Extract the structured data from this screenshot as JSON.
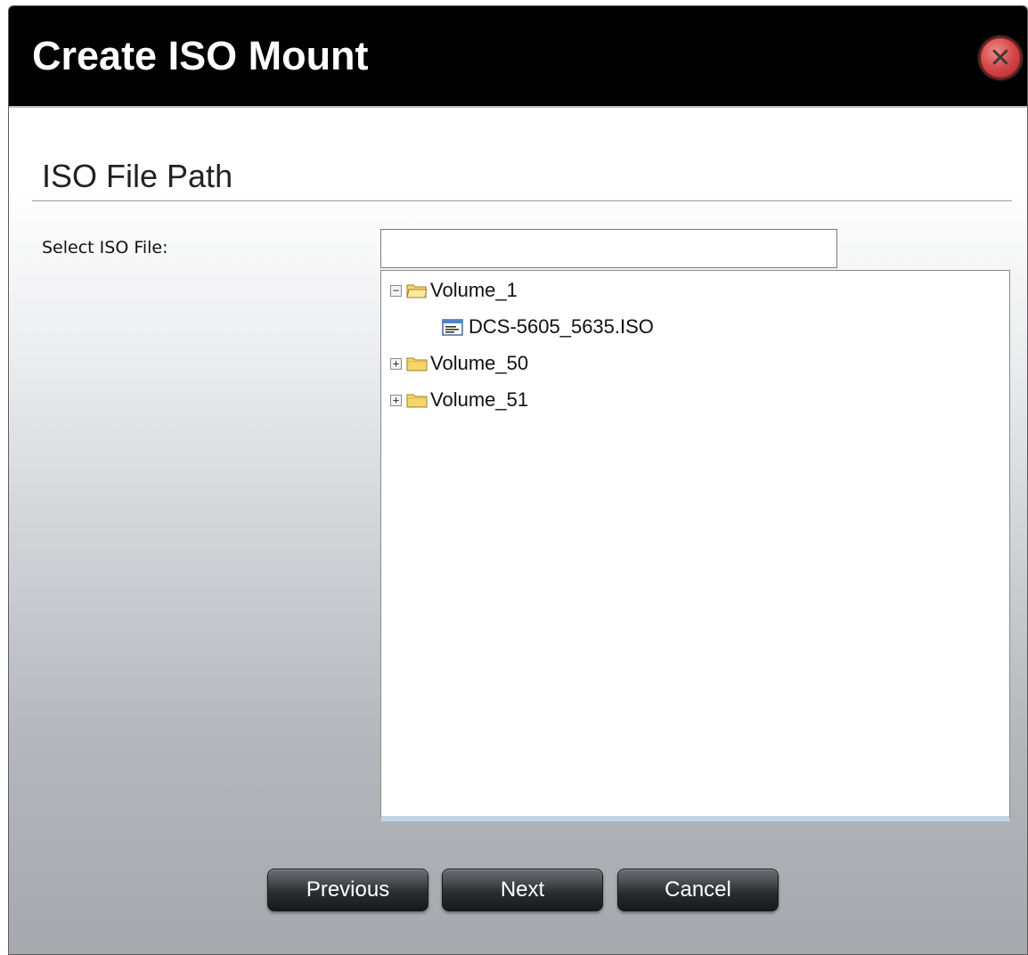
{
  "dialog": {
    "title": "Create ISO Mount",
    "close_icon": "close-icon"
  },
  "section": {
    "title": "ISO File Path"
  },
  "form": {
    "select_label": "Select ISO File:",
    "select_value": ""
  },
  "tree": {
    "nodes": [
      {
        "label": "Volume_1",
        "type": "folder",
        "state": "expanded",
        "expander": "−",
        "icon": "folder-open-icon"
      },
      {
        "label": "DCS-5605_5635.ISO",
        "type": "file",
        "icon": "iso-file-icon"
      },
      {
        "label": "Volume_50",
        "type": "folder",
        "state": "collapsed",
        "expander": "+",
        "icon": "folder-icon"
      },
      {
        "label": "Volume_51",
        "type": "folder",
        "state": "collapsed",
        "expander": "+",
        "icon": "folder-icon"
      }
    ]
  },
  "buttons": {
    "previous": "Previous",
    "next": "Next",
    "cancel": "Cancel"
  },
  "colors": {
    "titlebar": "#000000",
    "close_red": "#d44a4a",
    "folder_yellow": "#f5d66b",
    "tree_bottom_border": "#c3d3e6"
  }
}
